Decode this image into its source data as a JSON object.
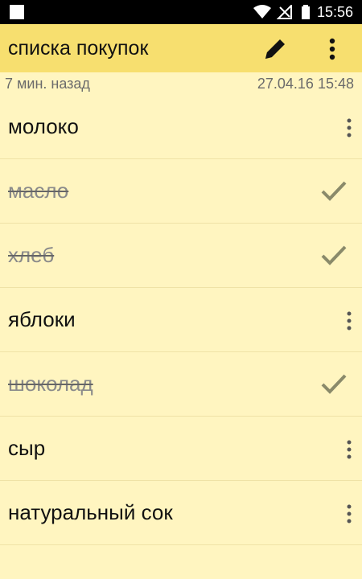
{
  "status_bar": {
    "time": "15:56",
    "icons": [
      "notification-square-icon",
      "wifi-icon",
      "signal-icon",
      "battery-icon"
    ]
  },
  "toolbar": {
    "title": "списка покупок",
    "icons": [
      "pencil-icon",
      "overflow-menu-icon"
    ]
  },
  "meta": {
    "modified_ago": "7 мин. назад",
    "timestamp": "27.04.16 15:48"
  },
  "items": [
    {
      "label": "молоко",
      "done": false
    },
    {
      "label": "масло",
      "done": true
    },
    {
      "label": "хлеб",
      "done": true
    },
    {
      "label": "яблоки",
      "done": false
    },
    {
      "label": "шоколад",
      "done": true
    },
    {
      "label": "сыр",
      "done": false
    },
    {
      "label": "натуральный сок",
      "done": false
    }
  ],
  "colors": {
    "toolbar_bg": "#f7df6f",
    "page_bg": "#fff5c0",
    "done_text": "#8a8a8a"
  }
}
